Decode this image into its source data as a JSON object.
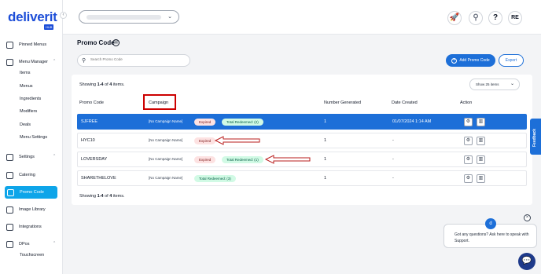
{
  "app": {
    "logo": "deliverit",
    "logo_sub": "HUB"
  },
  "sidebar": {
    "collapse": "‹",
    "items": [
      {
        "label": "Pinned Menus"
      },
      {
        "label": "Menu Manager"
      },
      {
        "label": "Settings"
      },
      {
        "label": "Catering"
      },
      {
        "label": "Promo Code"
      },
      {
        "label": "Image Library"
      },
      {
        "label": "Integrations"
      },
      {
        "label": "DPos"
      }
    ],
    "menu_sub": [
      "Items",
      "Menus",
      "Ingredients",
      "Modifiers",
      "Deals",
      "Menu Settings"
    ],
    "dpos_sub": [
      "Touchscreen"
    ],
    "chevron": "⌃"
  },
  "topbar": {
    "location_chevron": "⌄",
    "icons": {
      "rocket": "🚀",
      "help": "?",
      "avatar": "RE"
    }
  },
  "main": {
    "title": "Promo Code",
    "search_placeholder": "Search Promo Code",
    "add_button": "Add Promo Code",
    "export_button": "Export",
    "page_size": "Show 25 items",
    "summary_top": {
      "prefix": "Showing ",
      "range": "1-4",
      "mid": " of ",
      "total": "4",
      "suffix": " items."
    },
    "summary_bottom": {
      "prefix": "Showing ",
      "range": "1-4",
      "mid": " of ",
      "total": "4",
      "suffix": " items."
    },
    "columns": [
      "Promo Code",
      "Campaign",
      "Number Generated",
      "Date Created",
      "Action"
    ],
    "rows": [
      {
        "code": "SJFREE",
        "campaign": "[No Campaign Name]",
        "expired": "Expired",
        "redeemed": "Total Redeemed: (2)",
        "generated": "1",
        "date": "01/07/2024 1:14 AM"
      },
      {
        "code": "HYC10",
        "campaign": "[No Campaign Name]",
        "expired": "Expired",
        "redeemed": "",
        "generated": "1",
        "date": "-"
      },
      {
        "code": "LOVERSDAY",
        "campaign": "[No Campaign Name]",
        "expired": "Expired",
        "redeemed": "Total Redeemed: (1)",
        "generated": "1",
        "date": "-"
      },
      {
        "code": "SHARETHELOVE",
        "campaign": "[No Campaign Name]",
        "expired": "",
        "redeemed": "Total Redeemed: (3)",
        "generated": "1",
        "date": "-"
      }
    ]
  },
  "feedback": "Feedback",
  "chat": {
    "message": "Got any questions? Ask here to speak with Support.",
    "close": "×"
  },
  "colors": {
    "primary": "#1d6fd8",
    "annotation": "#cc0000",
    "active_nav": "#0ea5e9"
  }
}
